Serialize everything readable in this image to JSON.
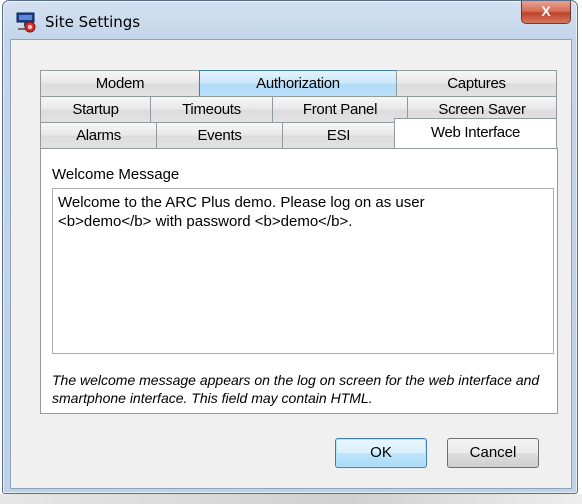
{
  "window": {
    "title": "Site Settings",
    "close_label": "X"
  },
  "tabs": {
    "row1": [
      {
        "label": "Modem"
      },
      {
        "label": "Authorization"
      },
      {
        "label": "Captures"
      }
    ],
    "row2": [
      {
        "label": "Startup"
      },
      {
        "label": "Timeouts"
      },
      {
        "label": "Front Panel"
      },
      {
        "label": "Screen Saver"
      }
    ],
    "row3": [
      {
        "label": "Alarms"
      },
      {
        "label": "Events"
      },
      {
        "label": "ESI"
      },
      {
        "label": "Web Interface"
      }
    ],
    "selected": "Web Interface",
    "hovered": "Authorization"
  },
  "panel": {
    "field_label": "Welcome Message",
    "welcome_message": "Welcome to the ARC Plus demo. Please log on as user\n<b>demo</b> with password <b>demo</b>.",
    "note": "The welcome message appears on the log on screen for the web interface and smartphone interface. This field may contain HTML."
  },
  "buttons": {
    "ok": "OK",
    "cancel": "Cancel"
  }
}
